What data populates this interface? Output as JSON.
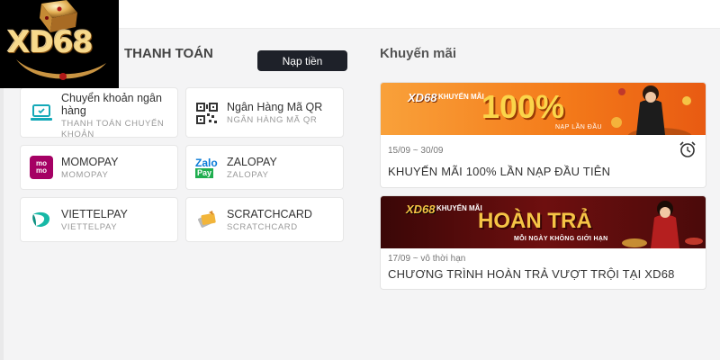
{
  "logo": {
    "text": "XD68"
  },
  "payment": {
    "title": "THANH TOÁN",
    "deposit_label": "Nạp tiền",
    "methods": [
      {
        "name": "Chuyển khoản ngân hàng",
        "sub": "THANH TOÁN CHUYỂN KHOẢN",
        "icon": "laptop-payment-icon"
      },
      {
        "name": "Ngân Hàng Mã QR",
        "sub": "NGÂN HÀNG MÃ QR",
        "icon": "qr-code-icon"
      },
      {
        "name": "MOMOPAY",
        "sub": "MOMOPAY",
        "icon": "momo-icon"
      },
      {
        "name": "ZALOPAY",
        "sub": "ZALOPAY",
        "icon": "zalopay-icon"
      },
      {
        "name": "VIETTELPAY",
        "sub": "VIETTELPAY",
        "icon": "viettelpay-icon"
      },
      {
        "name": "SCRATCHCARD",
        "sub": "SCRATCHCARD",
        "icon": "scratchcard-icon"
      }
    ]
  },
  "promotions": {
    "title": "Khuyến mãi",
    "items": [
      {
        "banner_brand": "XD68",
        "banner_tag": "KHUYẾN MÃI",
        "banner_headline": "100%",
        "banner_sub": "NẠP LẦN ĐẦU",
        "date": "15/09 ~ 30/09",
        "name": "KHUYẾN MÃI 100% LẦN NẠP ĐẦU TIÊN",
        "icon": "alarm-clock-icon"
      },
      {
        "banner_brand": "XD68",
        "banner_tag": "KHUYẾN MÃI",
        "banner_headline": "HOÀN TRẢ",
        "banner_sub": "MỖI NGÀY KHÔNG GIỚI HẠN",
        "date": "17/09 ~ vô thời hạn",
        "name": "CHƯƠNG TRÌNH HOÀN TRẢ VƯỢT TRỘI TẠI XD68"
      }
    ]
  },
  "colors": {
    "dark_button": "#1e2129",
    "banner_orange": "#f47b1a",
    "banner_dark_red": "#6e0f0f",
    "gold": "#f5c445"
  }
}
